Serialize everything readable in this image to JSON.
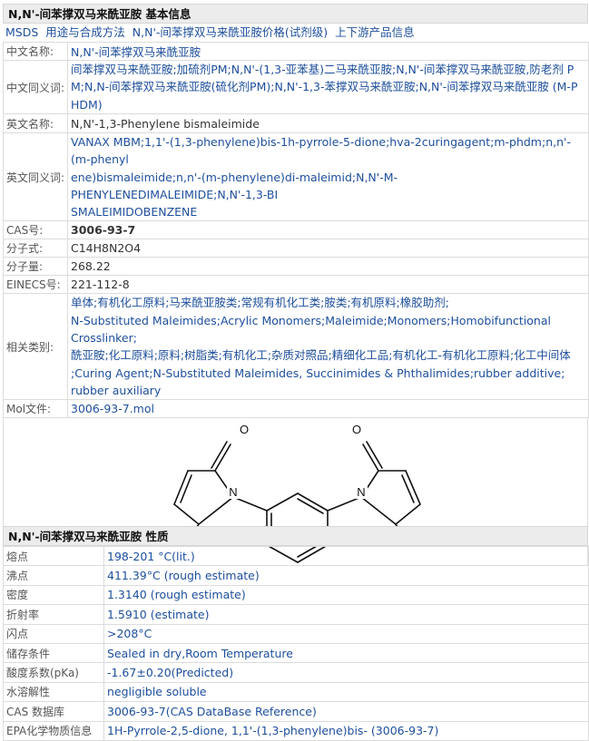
{
  "section1": {
    "title": "N,N'-间苯撑双马来酰亚胺 基本信息",
    "links": [
      "MSDS",
      "用途与合成方法",
      "N,N'-间苯撑双马来酰亚胺价格(试剂级)",
      "上下游产品信息"
    ],
    "rows": {
      "cn_name": {
        "label": "中文名称:",
        "value": "N,N'-间苯撑双马来酰亚胺"
      },
      "cn_syn": {
        "label": "中文同义词:",
        "lines": [
          "间苯撑双马来酰亚胺;加硫剂PM;N,N'-(1,3-亚苯基)二马来酰亚胺;N,N'-间苯撑双马来酰亚胺,防老剂 P",
          "M;N,N-间苯撑双马来酰亚胺(硫化剂PM);N,N'-1,3-苯撑双马来酰亚胺;N,N'-间苯撑双马来酰亚胺 (M-P",
          "HDM)"
        ]
      },
      "en_name": {
        "label": "英文名称:",
        "value": "N,N'-1,3-Phenylene bismaleimide"
      },
      "en_syn": {
        "label": "英文同义词:",
        "lines": [
          "VANAX MBM;1,1'-(1,3-phenylene)bis-1h-pyrrole-5-dione;hva-2curingagent;m-phdm;n,n'-(m-phenyl",
          "ene)bismaleimide;n,n'-(m-phenylene)di-maleimid;N,N'-M-PHENYLENEDIMALEIMIDE;N,N'-1,3-BI",
          "SMALEIMIDOBENZENE"
        ]
      },
      "cas": {
        "label": "CAS号:",
        "value": "3006-93-7"
      },
      "formula": {
        "label": "分子式:",
        "value": "C14H8N2O4"
      },
      "mw": {
        "label": "分子量:",
        "value": "268.22"
      },
      "einecs": {
        "label": "EINECS号:",
        "value": "221-112-8"
      },
      "category": {
        "label": "相关类别:",
        "lines": [
          "单体;有机化工原料;马来酰亚胺类;常规有机化工类;胺类;有机原料;橡胶助剂;",
          "N-Substituted Maleimides;Acrylic Monomers;Maleimide;Monomers;Homobifunctional Crosslinker;",
          "酰亚胺;化工原料;原料;树脂类;有机化工;杂质对照品;精细化工品;有机化工-有机化工原料;化工中间体",
          ";Curing Agent;N-Substituted Maleimides, Succinimides & Phthalimides;rubber additive;",
          "rubber auxiliary"
        ]
      },
      "mol": {
        "label": "Mol文件:",
        "value": "3006-93-7.mol"
      }
    },
    "structure": {
      "atoms": [
        "O",
        "N",
        "O",
        "O",
        "N",
        "O"
      ]
    }
  },
  "section2": {
    "title": "N,N'-间苯撑双马来酰亚胺 性质",
    "rows": [
      {
        "label": "熔点",
        "value": "198-201 °C(lit.)"
      },
      {
        "label": "沸点",
        "value": "411.39°C (rough estimate)"
      },
      {
        "label": "密度",
        "value": "1.3140 (rough estimate)"
      },
      {
        "label": "折射率",
        "value": "1.5910 (estimate)"
      },
      {
        "label": "闪点",
        "value": ">208°C"
      },
      {
        "label": "储存条件",
        "value": "Sealed in dry,Room Temperature"
      },
      {
        "label": "酸度系数(pKa)",
        "value": "-1.67±0.20(Predicted)"
      },
      {
        "label": "水溶解性",
        "value": "negligible soluble"
      },
      {
        "label": "CAS 数据库",
        "value": "3006-93-7(CAS DataBase Reference)"
      },
      {
        "label": "EPA化学物质信息",
        "value": "1H-Pyrrole-2,5-dione, 1,1'-(1,3-phenylene)bis- (3006-93-7)"
      }
    ]
  }
}
